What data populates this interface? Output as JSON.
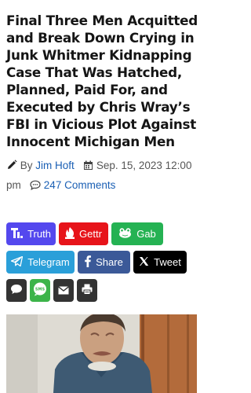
{
  "article": {
    "headline": "Final Three Men Acquitted and Break Down Crying in Junk Whitmer Kidnapping Case That Was Hatched, Planned, Paid For, and Executed by Chris Wray’s FBI in Vicious Plot Against Innocent Michigan Men",
    "by_prefix": "By",
    "author": "Jim Hoft",
    "date": "Sep. 15, 2023 12:00 pm",
    "comments": "247 Comments"
  },
  "share": {
    "truth": "Truth",
    "gettr": "Gettr",
    "gab": "Gab",
    "telegram": "Telegram",
    "facebook": "Share",
    "tweet": "Tweet",
    "sms": "SMS"
  },
  "icons": {
    "author": "pencil-icon",
    "date": "calendar-icon",
    "comments": "comment-icon",
    "truth": "truth-social-icon",
    "gettr": "gettr-icon",
    "gab": "gab-frog-icon",
    "telegram": "telegram-icon",
    "facebook": "facebook-icon",
    "tweet": "x-icon",
    "comment_share": "speech-bubble-icon",
    "sms": "sms-icon",
    "mail": "envelope-icon",
    "print": "printer-icon"
  },
  "colors": {
    "truth": "#5448ee",
    "gettr": "#e7141a",
    "gab": "#25b253",
    "telegram": "#2a9fd9",
    "facebook": "#3b5998",
    "tweet": "#000000",
    "link": "#1a5fb4"
  }
}
